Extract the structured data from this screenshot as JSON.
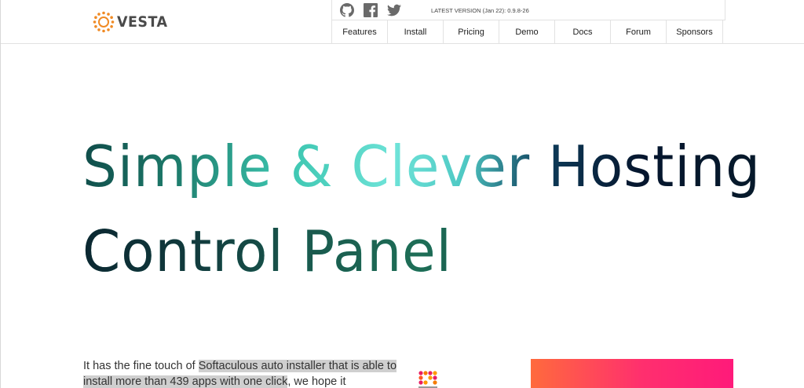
{
  "brand": {
    "name": "VESTA",
    "logo_icon": "sun-ring-icon",
    "logo_color": "#f08a24"
  },
  "topbar": {
    "social": [
      {
        "name": "github-icon"
      },
      {
        "name": "facebook-icon"
      },
      {
        "name": "twitter-icon"
      }
    ],
    "version_text": "LATEST VERSION (Jan 22): 0.9.8-26"
  },
  "nav": {
    "items": [
      "Features",
      "Install",
      "Pricing",
      "Demo",
      "Docs",
      "Forum",
      "Sponsors"
    ]
  },
  "hero": {
    "line1": "Simple & Clever Hosting",
    "line2": "Control Panel"
  },
  "intro": {
    "part1": "It has the fine touch of ",
    "highlight": "Softaculous auto installer that is able to install more than 439 apps with one click",
    "part2": ", we hope it"
  },
  "colors": {
    "accent_orange": "#ff6a3d",
    "accent_pink": "#ff1a7a"
  }
}
